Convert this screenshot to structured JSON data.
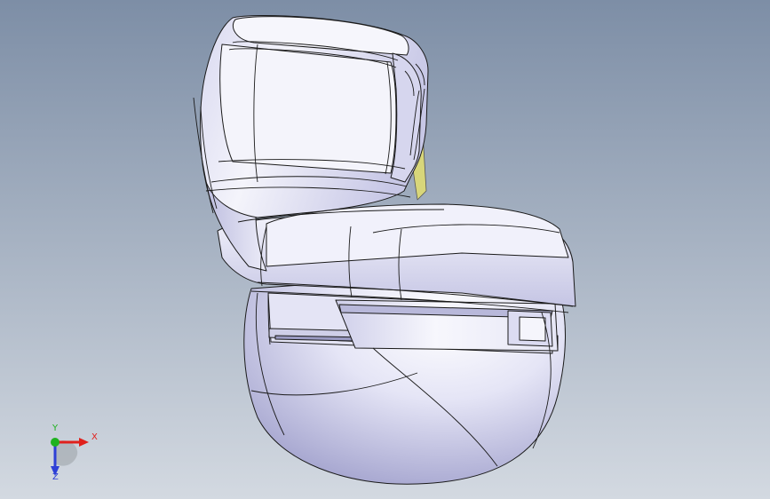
{
  "viewport": {
    "background_top": "#7d8ea6",
    "background_bottom": "#d3d9e1",
    "model_color": "#e9e9f7",
    "model_shadow": "#a9a9cf",
    "edge_color": "#1a1a1a",
    "hidden_face_color": "#d8d67a"
  },
  "triad": {
    "x_label": "X",
    "y_label": "Y",
    "z_label": "Z",
    "x_color": "#e0201c",
    "y_color": "#1fb21f",
    "z_color": "#2d3fd6"
  }
}
